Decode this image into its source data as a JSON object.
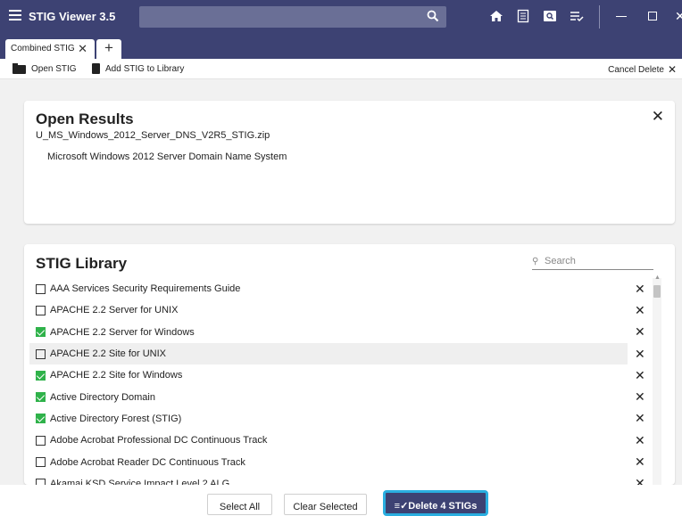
{
  "app": {
    "title": "STIG Viewer 3.5"
  },
  "tabs": [
    {
      "label": "Combined STIG",
      "close": "✕"
    }
  ],
  "toolbar": {
    "open_label": "Open STIG",
    "add_label": "Add STIG to Library",
    "cancel_label": "Cancel Delete"
  },
  "open_results": {
    "title": "Open Results",
    "file": "U_MS_Windows_2012_Server_DNS_V2R5_STIG.zip",
    "description": "Microsoft Windows 2012 Server Domain Name System"
  },
  "library": {
    "title": "STIG Library",
    "search_placeholder": "Search",
    "items": [
      {
        "label": "AAA Services Security Requirements Guide",
        "checked": false
      },
      {
        "label": "APACHE 2.2 Server for UNIX",
        "checked": false
      },
      {
        "label": "APACHE 2.2 Server for Windows",
        "checked": true
      },
      {
        "label": "APACHE 2.2 Site for UNIX",
        "checked": false,
        "highlighted": true
      },
      {
        "label": "APACHE 2.2 Site for Windows",
        "checked": true
      },
      {
        "label": "Active Directory Domain",
        "checked": true
      },
      {
        "label": "Active Directory Forest (STIG)",
        "checked": true
      },
      {
        "label": "Adobe Acrobat Professional DC Continuous Track",
        "checked": false
      },
      {
        "label": "Adobe Acrobat Reader DC Continuous Track",
        "checked": false
      },
      {
        "label": "Akamai KSD Service Impact Level 2 ALG",
        "checked": false
      }
    ]
  },
  "footer": {
    "select_all": "Select All",
    "clear_selected": "Clear Selected",
    "delete_label": "Delete 4 STIGs"
  }
}
